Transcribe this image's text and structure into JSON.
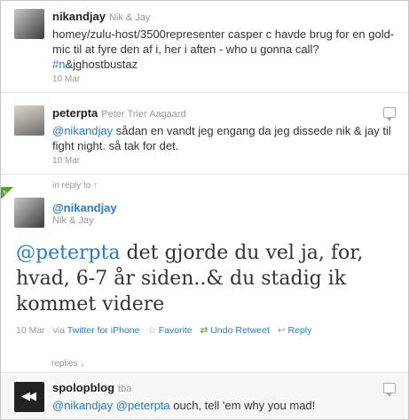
{
  "tweets": [
    {
      "username": "nikandjay",
      "realname": "Nik & Jay",
      "text_plain": "homey/zulu-host/3500representer casper c havde brug for en gold-mic til at fyre den af i, her i aften - who u gonna call? ",
      "hashtag": "#n",
      "text_after": "&jghostbustaz",
      "date": "10 Mar"
    },
    {
      "username": "peterpta",
      "realname": "Peter Trier Aagaard",
      "mention": "@nikandjay",
      "text": " sådan en vandt jeg engang da jeg dissede nik & jay til fight night. så tak for det.",
      "date": "10 Mar"
    },
    {
      "in_reply_label": "in reply to ↑",
      "username": "@nikandjay",
      "realname": "Nik & Jay",
      "mention": "@peterpta",
      "text": " det gjorde du vel ja, for, hvad, 6-7 år siden..& du stadig ik kommet videre",
      "date": "10 Mar",
      "via": "via",
      "client": "Twitter for iPhone",
      "favorite": "Favorite",
      "undo_retweet": "Undo Retweet",
      "reply": "Reply"
    },
    {
      "username": "spolopblog",
      "realname": "tba",
      "mention1": "@nikandjay",
      "mention2": "@peterpta",
      "text": " ouch, tell 'em why you mad!"
    }
  ],
  "replies_label": "replies ↓",
  "colors": {
    "link": "#2a7bbd",
    "retweet": "#5aa02c",
    "ribbon": "#5aa02c"
  }
}
